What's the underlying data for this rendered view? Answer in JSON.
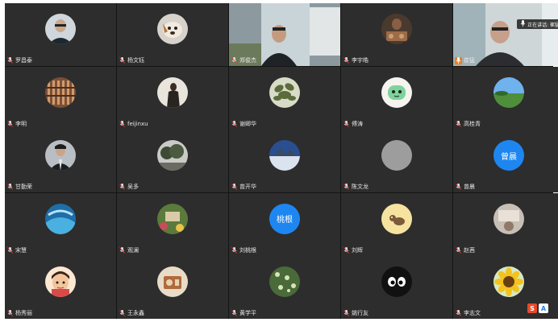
{
  "participants": [
    {
      "name": "罗昌泰",
      "avatar": "photo-man-glasses"
    },
    {
      "name": "杨文钰",
      "avatar": "photo-dog"
    },
    {
      "name": "郑俊杰",
      "avatar": "video-live"
    },
    {
      "name": "李宇皓",
      "avatar": "photo-person-food"
    },
    {
      "name": "崔猛",
      "avatar": "video-live-speaking",
      "speaking_label": "正在讲话: 崔猛"
    },
    {
      "name": "李明",
      "avatar": "photo-bookshelf"
    },
    {
      "name": "feijinxu",
      "avatar": "photo-dark-figure"
    },
    {
      "name": "谢卿华",
      "avatar": "photo-plant"
    },
    {
      "name": "傅涛",
      "avatar": "photo-cartoon"
    },
    {
      "name": "高桂青",
      "avatar": "photo-landscape"
    },
    {
      "name": "甘勤荣",
      "avatar": "photo-man-suit"
    },
    {
      "name": "吴多",
      "avatar": "photo-trees"
    },
    {
      "name": "曾开华",
      "avatar": "photo-lake"
    },
    {
      "name": "陈文龙",
      "avatar": "gray-circle"
    },
    {
      "name": "曾晨",
      "avatar": "text",
      "avatar_text": "曾晨"
    },
    {
      "name": "宋慧",
      "avatar": "photo-blue-swirl"
    },
    {
      "name": "观澜",
      "avatar": "photo-garden"
    },
    {
      "name": "刘桃根",
      "avatar": "text",
      "avatar_text": "桃根"
    },
    {
      "name": "刘辉",
      "avatar": "photo-cartoon-cat"
    },
    {
      "name": "赵茜",
      "avatar": "photo-room"
    },
    {
      "name": "杨秀丽",
      "avatar": "photo-cartoon-girl"
    },
    {
      "name": "王永鑫",
      "avatar": "photo-radio"
    },
    {
      "name": "黄学平",
      "avatar": "photo-flowers"
    },
    {
      "name": "姚行友",
      "avatar": "photo-eyes"
    },
    {
      "name": "李志文",
      "avatar": "photo-sunflower"
    }
  ],
  "colors": {
    "accent": "#1e86f0",
    "speaking": "#f07d1e",
    "tile": "#2d2d2d"
  },
  "icons": [
    "mic-off-icon",
    "mic-icon",
    "ime-s-icon",
    "ime-a-icon"
  ],
  "tray": {
    "ime_s": "S",
    "ime_a": "A"
  }
}
